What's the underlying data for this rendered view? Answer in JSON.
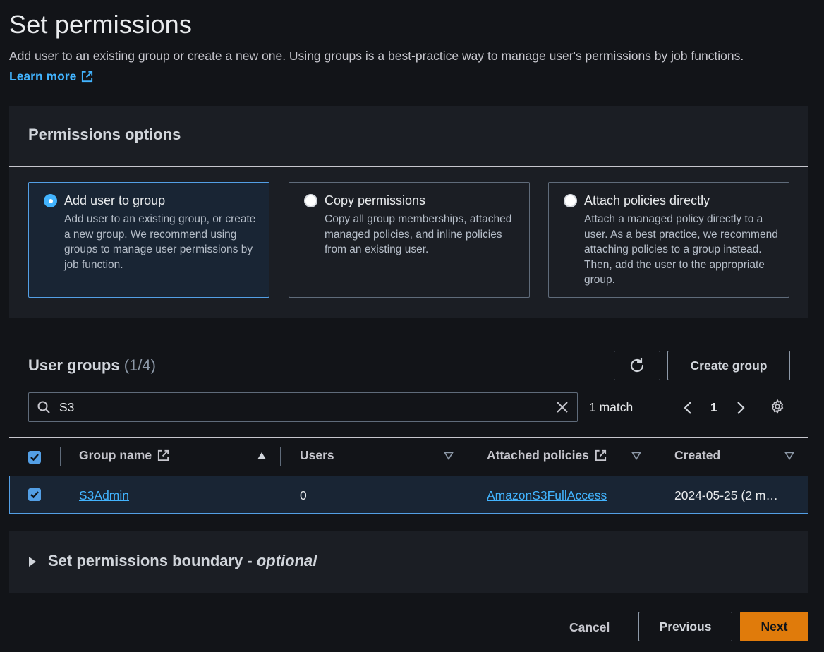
{
  "header": {
    "title": "Set permissions",
    "subtitle": "Add user to an existing group or create a new one. Using groups is a best-practice way to manage user's permissions by job functions.",
    "learn_more": "Learn more"
  },
  "permissions_options": {
    "heading": "Permissions options",
    "options": [
      {
        "label": "Add user to group",
        "desc": "Add user to an existing group, or create a new group. We recommend using groups to manage user permissions by job function.",
        "selected": true
      },
      {
        "label": "Copy permissions",
        "desc": "Copy all group memberships, attached managed policies, and inline policies from an existing user.",
        "selected": false
      },
      {
        "label": "Attach policies directly",
        "desc": "Attach a managed policy directly to a user. As a best practice, we recommend attaching policies to a group instead. Then, add the user to the appropriate group.",
        "selected": false
      }
    ]
  },
  "user_groups": {
    "title": "User groups",
    "count": "(1/4)",
    "create_label": "Create group",
    "search": {
      "value": "S3",
      "placeholder": ""
    },
    "match_text": "1 match",
    "page": "1",
    "columns": [
      "Group name",
      "Users",
      "Attached policies",
      "Created"
    ],
    "rows": [
      {
        "group_name": "S3Admin",
        "users": "0",
        "policies": "AmazonS3FullAccess",
        "created": "2024-05-25 (2 m…",
        "checked": true
      }
    ]
  },
  "boundary": {
    "title": "Set permissions boundary - ",
    "optional": "optional"
  },
  "footer": {
    "cancel": "Cancel",
    "previous": "Previous",
    "next": "Next"
  },
  "colors": {
    "accent": "#42b4ff",
    "primary_button": "#e07b0b",
    "selected_border": "#539fe5"
  }
}
